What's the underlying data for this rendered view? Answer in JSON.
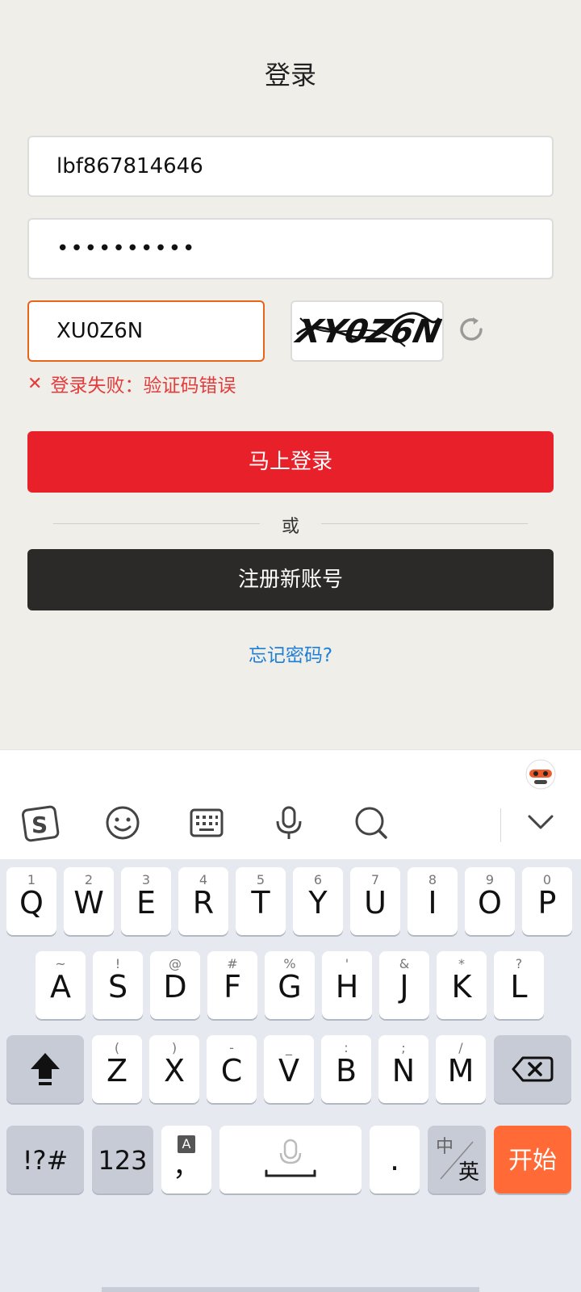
{
  "login": {
    "title": "登录",
    "username_value": "lbf867814646",
    "password_value": "••••••••••",
    "captcha_value": "XU0Z6N",
    "captcha_image_text": "XY0Z6N",
    "error_message": "登录失败：验证码错误",
    "login_button": "马上登录",
    "divider_text": "或",
    "register_button": "注册新账号",
    "forgot_password": "忘记密码?"
  },
  "colors": {
    "accent_red": "#e8202a",
    "error_red": "#e53b3b",
    "link_blue": "#1e7fd6",
    "captcha_border": "#e8641b",
    "register_dark": "#2c2a29",
    "enter_key": "#ff6a37"
  },
  "ime_toolbar": {
    "icons": [
      "sogou-logo-icon",
      "emoji-icon",
      "keyboard-icon",
      "microphone-icon",
      "search-icon",
      "collapse-chevron-icon"
    ]
  },
  "keyboard": {
    "row1": [
      {
        "main": "Q",
        "sub": "1"
      },
      {
        "main": "W",
        "sub": "2"
      },
      {
        "main": "E",
        "sub": "3"
      },
      {
        "main": "R",
        "sub": "4"
      },
      {
        "main": "T",
        "sub": "5"
      },
      {
        "main": "Y",
        "sub": "6"
      },
      {
        "main": "U",
        "sub": "7"
      },
      {
        "main": "I",
        "sub": "8"
      },
      {
        "main": "O",
        "sub": "9"
      },
      {
        "main": "P",
        "sub": "0"
      }
    ],
    "row2": [
      {
        "main": "A",
        "sub": "~"
      },
      {
        "main": "S",
        "sub": "!"
      },
      {
        "main": "D",
        "sub": "@"
      },
      {
        "main": "F",
        "sub": "#"
      },
      {
        "main": "G",
        "sub": "%"
      },
      {
        "main": "H",
        "sub": "'"
      },
      {
        "main": "J",
        "sub": "&"
      },
      {
        "main": "K",
        "sub": "*"
      },
      {
        "main": "L",
        "sub": "?"
      }
    ],
    "row3": [
      {
        "main": "Z",
        "sub": "("
      },
      {
        "main": "X",
        "sub": ")"
      },
      {
        "main": "C",
        "sub": "-"
      },
      {
        "main": "V",
        "sub": "_"
      },
      {
        "main": "B",
        "sub": ":"
      },
      {
        "main": "N",
        "sub": ";"
      },
      {
        "main": "M",
        "sub": "/"
      }
    ],
    "symbols_key": "!?#",
    "numbers_key": "123",
    "comma_key": "，",
    "period_key": ".",
    "lang_key_top": "中",
    "lang_key_bottom": "英",
    "enter_key": "开始"
  }
}
